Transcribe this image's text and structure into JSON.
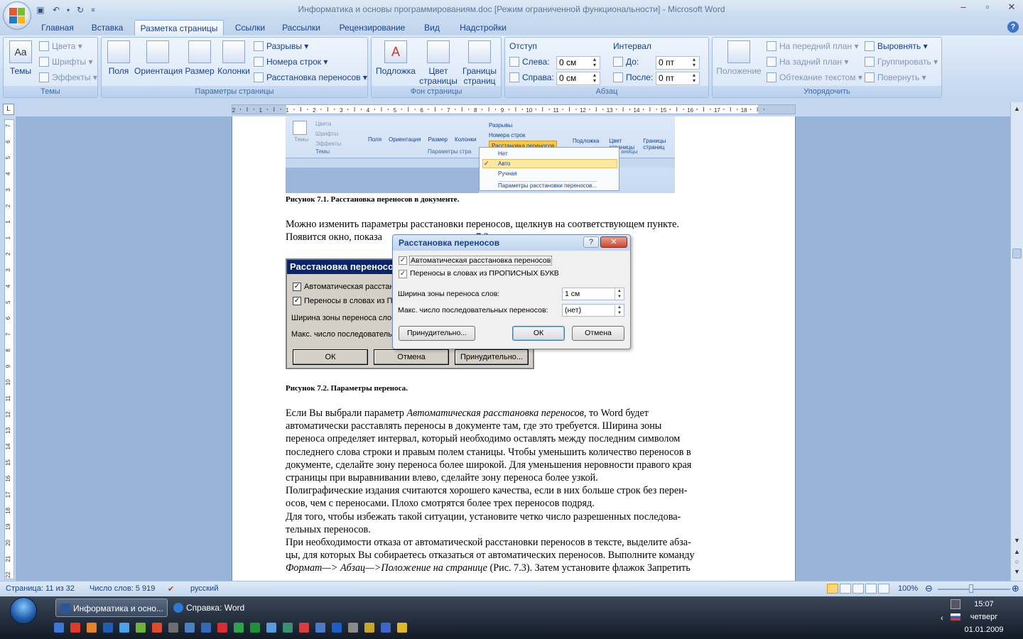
{
  "window": {
    "title": "Информатика и основы программированиям.doc [Режим ограниченной функциональности] - Microsoft Word"
  },
  "tabs": [
    "Главная",
    "Вставка",
    "Разметка страницы",
    "Ссылки",
    "Рассылки",
    "Рецензирование",
    "Вид",
    "Надстройки"
  ],
  "active_tab": "Разметка страницы",
  "ribbon": {
    "themes": {
      "label": "Темы",
      "themes_btn": "Темы",
      "colors": "Цвета",
      "fonts": "Шрифты",
      "effects": "Эффекты"
    },
    "page_setup": {
      "label": "Параметры страницы",
      "margins": "Поля",
      "orientation": "Ориентация",
      "size": "Размер",
      "columns": "Колонки",
      "breaks": "Разрывы",
      "line_numbers": "Номера строк",
      "hyphenation": "Расстановка переносов"
    },
    "background": {
      "label": "Фон страницы",
      "watermark": "Подложка",
      "page_color_1": "Цвет",
      "page_color_2": "страницы",
      "borders_1": "Границы",
      "borders_2": "страниц"
    },
    "paragraph": {
      "label": "Абзац",
      "indent": "Отступ",
      "left": "Слева:",
      "left_val": "0 см",
      "right": "Справа:",
      "right_val": "0 см",
      "spacing": "Интервал",
      "before": "До:",
      "before_val": "0 пт",
      "after": "После:",
      "after_val": "0 пт"
    },
    "arrange": {
      "label": "Упорядочить",
      "position": "Положение",
      "front": "На передний план",
      "back": "На задний план",
      "wrap": "Обтекание текстом",
      "align": "Выровнять",
      "group": "Группировать",
      "rotate": "Повернуть"
    }
  },
  "ruler": {
    "h_ticks": [
      "2",
      "1",
      "1",
      "2",
      "3",
      "4",
      "5",
      "6",
      "7",
      "8",
      "9",
      "10",
      "11",
      "12",
      "13",
      "14",
      "15",
      "16",
      "17",
      "18"
    ],
    "v_ticks": [
      "7",
      "6",
      "5",
      "4",
      "3",
      "2",
      "1",
      "1",
      "2",
      "3",
      "4",
      "5",
      "6",
      "7",
      "8",
      "9",
      "10",
      "11",
      "12",
      "13",
      "14",
      "15",
      "16",
      "17",
      "18",
      "19",
      "20",
      "21",
      "22"
    ]
  },
  "fig1": {
    "themes": "Темы",
    "colors": "Цвета",
    "fonts": "Шрифты",
    "effects": "Эффекты",
    "group_themes": "Темы",
    "margins": "Поля",
    "orientation": "Ориентация",
    "size": "Размер",
    "columns": "Колонки",
    "breaks": "Разрывы",
    "line_numbers": "Номера строк",
    "hyphenation": "Расстановка переносов",
    "group_page": "Параметры стра",
    "watermark": "Подложка",
    "page_color": "Цвет страницы",
    "borders": "Границы страниц",
    "group_bg": "аницы",
    "menu": [
      "Нет",
      "Авто",
      "Ручная",
      "Параметры расстановки переносов..."
    ]
  },
  "document": {
    "caption1": "Рисунок 7.1. Расстановка переносов в документе.",
    "para1_line1": "Можно изменить параметры расстановки переносов, щелкнув на соответствующем пункте.",
    "para1_line2a": "Появится окно, показа",
    "para1_line2b": "7.2.",
    "caption2": "Рисунок 7.2. Параметры переноса.",
    "p2": [
      {
        "pre": "Если Вы выбрали параметр ",
        "em": "Автоматическая расстановка переносов",
        "post": ", то Word будет"
      },
      {
        "pre": "автоматически расставлять переносы в документе там, где это требуется.   Ширина зоны",
        "em": "",
        "post": ""
      },
      {
        "pre": "переноса определяет интервал, который необходимо оставлять между последним символом",
        "em": "",
        "post": ""
      },
      {
        "pre": "последнего  слова строки и правым полем станицы. Чтобы уменьшить количество переносов в",
        "em": "",
        "post": ""
      },
      {
        "pre": "документе, сделайте зону переноса более широкой. Для уменьшения неровности правого края",
        "em": "",
        "post": ""
      },
      {
        "pre": "страницы при выравнивании влево, сделайте зону переноса более узкой.",
        "em": "",
        "post": ""
      },
      {
        "pre": "Полиграфические издания считаются хорошего качества,  если в них больше строк без перен-",
        "em": "",
        "post": ""
      },
      {
        "pre": "осов, чем с переносами. Плохо смотрятся  более трех переносов подряд.",
        "em": "",
        "post": ""
      },
      {
        "pre": "Для того, чтобы избежать такой ситуации, установите четко число разрешенных последова-",
        "em": "",
        "post": ""
      },
      {
        "pre": "тельных переносов.",
        "em": "",
        "post": ""
      },
      {
        "pre": "При необходимости отказа от автоматической расстановки переносов в тексте, выделите абза-",
        "em": "",
        "post": ""
      },
      {
        "pre": "цы, для которых  Вы собираетесь отказаться от автоматических переносов. Выполните команду",
        "em": "",
        "post": ""
      },
      {
        "pre": "",
        "em": "Формат—> Абзац—>Положение на странице",
        "post": " (Рис. 7.3). Затем установите флажок Запретить"
      }
    ]
  },
  "old_dialog": {
    "title": "Расстановка переносов",
    "auto": "Автоматическая расстановка",
    "caps": "Переносы в словах из ПР",
    "zone": "Ширина зоны переноса слов",
    "max": "Макс. число последовательн",
    "ok": "ОК",
    "cancel": "Отмена",
    "manual": "Принудительно..."
  },
  "new_dialog": {
    "title": "Расстановка переносов",
    "help": "?",
    "auto": "Автоматическая расстановка переносов",
    "caps": "Переносы в словах из ПРОПИСНЫХ БУКВ",
    "zone_label": "Ширина зоны переноса слов:",
    "zone_val": "1 см",
    "max_label": "Макс. число последовательных переносов:",
    "max_val": "(нет)",
    "manual": "Принудительно...",
    "ok": "ОК",
    "cancel": "Отмена"
  },
  "status": {
    "page": "Страница: 11 из 32",
    "words": "Число слов: 5 919",
    "lang": "русский",
    "zoom": "100%"
  },
  "taskbar": {
    "tasks": [
      "Информатика и осно...",
      "Справка: Word"
    ],
    "time": "15:07",
    "day": "четверг",
    "date": "01.01.2009"
  }
}
